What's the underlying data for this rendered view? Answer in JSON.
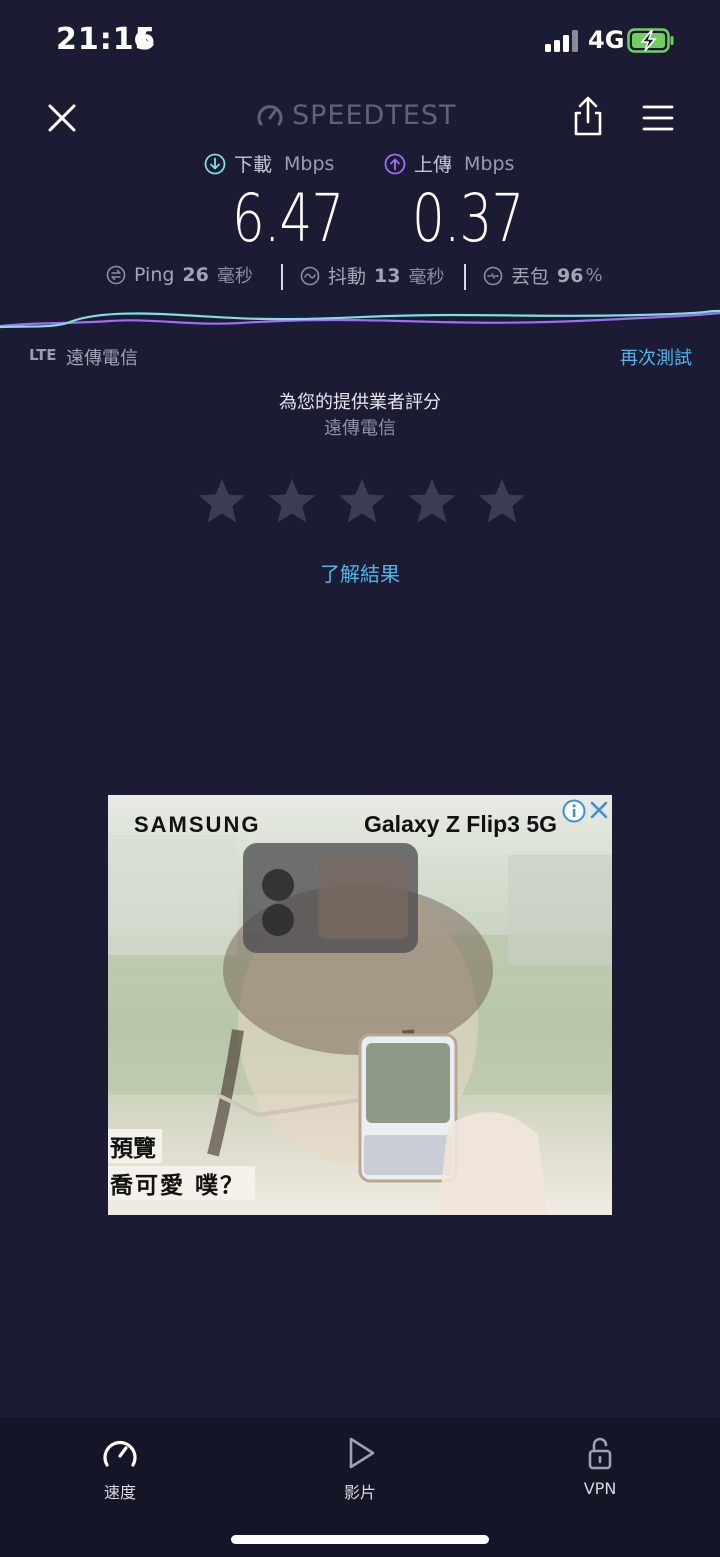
{
  "status_bar": {
    "time": "21:15",
    "network": "4G"
  },
  "header": {
    "brand": "SPEEDTEST"
  },
  "download": {
    "label": "下載",
    "unit": "Mbps",
    "value": "6.47"
  },
  "upload": {
    "label": "上傳",
    "unit": "Mbps",
    "value": "0.37"
  },
  "stats": {
    "ping": {
      "label": "Ping",
      "value": "26",
      "unit": "毫秒"
    },
    "jitter": {
      "label": "抖動",
      "value": "13",
      "unit": "毫秒"
    },
    "loss": {
      "label": "丟包",
      "value": "96",
      "unit": "%"
    }
  },
  "connection": {
    "type": "LTE",
    "carrier": "遠傳電信",
    "retest": "再次測試"
  },
  "rating": {
    "title": "為您的提供業者評分",
    "provider": "遠傳電信",
    "stars": 5,
    "learn_more": "了解結果"
  },
  "ad": {
    "brand": "SAMSUNG",
    "model": "Galaxy Z Flip3 5G",
    "caption_line1": "預覽",
    "caption_line2": "喬可愛",
    "caption_line2_suffix": "噗？"
  },
  "tabs": [
    {
      "label": "速度",
      "icon": "speed-gauge-icon"
    },
    {
      "label": "影片",
      "icon": "play-icon"
    },
    {
      "label": "VPN",
      "icon": "lock-icon"
    }
  ],
  "colors": {
    "background": "#1b1c33",
    "accent_blue": "#4fb5ea",
    "download_teal": "#7ee0e0",
    "upload_purple": "#a06cf0"
  }
}
